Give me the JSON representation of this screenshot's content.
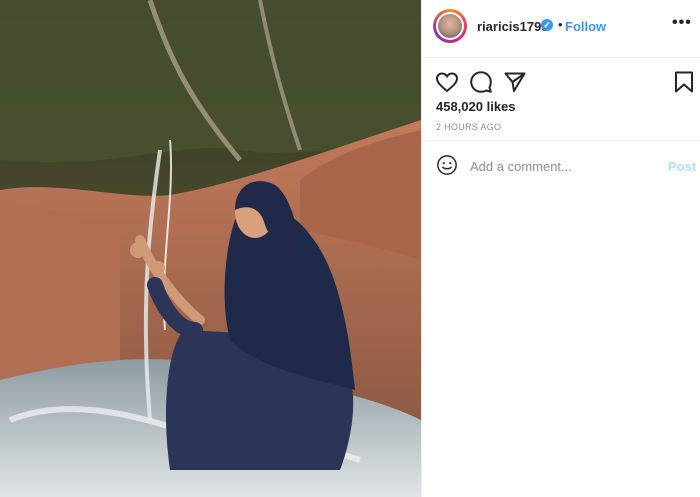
{
  "post": {
    "username": "riaricis1795",
    "verified_badge": "✓",
    "separator": "•",
    "follow_label": "Follow",
    "more_label": "•••",
    "likes": "458,020 likes",
    "timestamp": "2 HOURS AGO"
  },
  "comment": {
    "placeholder": "Add a comment...",
    "post_label": "Post"
  },
  "icons": {
    "like": "heart-icon",
    "comment": "comment-icon",
    "share": "send-icon",
    "save": "bookmark-icon",
    "emoji": "smiley-icon"
  },
  "colors": {
    "link": "#3897f0",
    "post_disabled": "#b2dffc",
    "muted": "#8e8e8e",
    "text": "#262626"
  }
}
